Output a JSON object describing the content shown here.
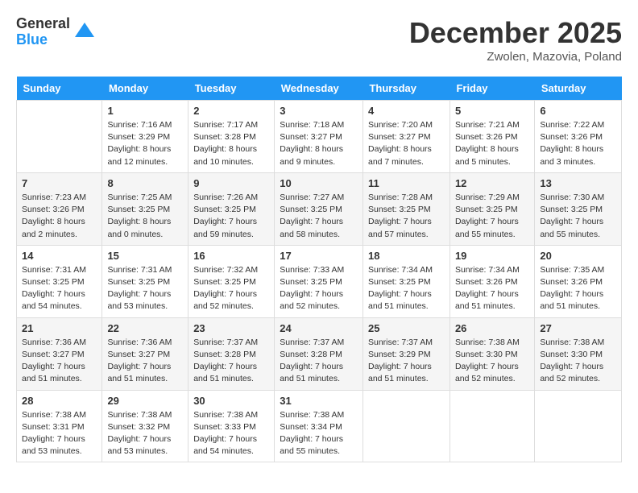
{
  "header": {
    "logo_general": "General",
    "logo_blue": "Blue",
    "month_title": "December 2025",
    "location": "Zwolen, Mazovia, Poland"
  },
  "days_of_week": [
    "Sunday",
    "Monday",
    "Tuesday",
    "Wednesday",
    "Thursday",
    "Friday",
    "Saturday"
  ],
  "weeks": [
    [
      {
        "day": "",
        "info": ""
      },
      {
        "day": "1",
        "info": "Sunrise: 7:16 AM\nSunset: 3:29 PM\nDaylight: 8 hours\nand 12 minutes."
      },
      {
        "day": "2",
        "info": "Sunrise: 7:17 AM\nSunset: 3:28 PM\nDaylight: 8 hours\nand 10 minutes."
      },
      {
        "day": "3",
        "info": "Sunrise: 7:18 AM\nSunset: 3:27 PM\nDaylight: 8 hours\nand 9 minutes."
      },
      {
        "day": "4",
        "info": "Sunrise: 7:20 AM\nSunset: 3:27 PM\nDaylight: 8 hours\nand 7 minutes."
      },
      {
        "day": "5",
        "info": "Sunrise: 7:21 AM\nSunset: 3:26 PM\nDaylight: 8 hours\nand 5 minutes."
      },
      {
        "day": "6",
        "info": "Sunrise: 7:22 AM\nSunset: 3:26 PM\nDaylight: 8 hours\nand 3 minutes."
      }
    ],
    [
      {
        "day": "7",
        "info": "Sunrise: 7:23 AM\nSunset: 3:26 PM\nDaylight: 8 hours\nand 2 minutes."
      },
      {
        "day": "8",
        "info": "Sunrise: 7:25 AM\nSunset: 3:25 PM\nDaylight: 8 hours\nand 0 minutes."
      },
      {
        "day": "9",
        "info": "Sunrise: 7:26 AM\nSunset: 3:25 PM\nDaylight: 7 hours\nand 59 minutes."
      },
      {
        "day": "10",
        "info": "Sunrise: 7:27 AM\nSunset: 3:25 PM\nDaylight: 7 hours\nand 58 minutes."
      },
      {
        "day": "11",
        "info": "Sunrise: 7:28 AM\nSunset: 3:25 PM\nDaylight: 7 hours\nand 57 minutes."
      },
      {
        "day": "12",
        "info": "Sunrise: 7:29 AM\nSunset: 3:25 PM\nDaylight: 7 hours\nand 55 minutes."
      },
      {
        "day": "13",
        "info": "Sunrise: 7:30 AM\nSunset: 3:25 PM\nDaylight: 7 hours\nand 55 minutes."
      }
    ],
    [
      {
        "day": "14",
        "info": "Sunrise: 7:31 AM\nSunset: 3:25 PM\nDaylight: 7 hours\nand 54 minutes."
      },
      {
        "day": "15",
        "info": "Sunrise: 7:31 AM\nSunset: 3:25 PM\nDaylight: 7 hours\nand 53 minutes."
      },
      {
        "day": "16",
        "info": "Sunrise: 7:32 AM\nSunset: 3:25 PM\nDaylight: 7 hours\nand 52 minutes."
      },
      {
        "day": "17",
        "info": "Sunrise: 7:33 AM\nSunset: 3:25 PM\nDaylight: 7 hours\nand 52 minutes."
      },
      {
        "day": "18",
        "info": "Sunrise: 7:34 AM\nSunset: 3:25 PM\nDaylight: 7 hours\nand 51 minutes."
      },
      {
        "day": "19",
        "info": "Sunrise: 7:34 AM\nSunset: 3:26 PM\nDaylight: 7 hours\nand 51 minutes."
      },
      {
        "day": "20",
        "info": "Sunrise: 7:35 AM\nSunset: 3:26 PM\nDaylight: 7 hours\nand 51 minutes."
      }
    ],
    [
      {
        "day": "21",
        "info": "Sunrise: 7:36 AM\nSunset: 3:27 PM\nDaylight: 7 hours\nand 51 minutes."
      },
      {
        "day": "22",
        "info": "Sunrise: 7:36 AM\nSunset: 3:27 PM\nDaylight: 7 hours\nand 51 minutes."
      },
      {
        "day": "23",
        "info": "Sunrise: 7:37 AM\nSunset: 3:28 PM\nDaylight: 7 hours\nand 51 minutes."
      },
      {
        "day": "24",
        "info": "Sunrise: 7:37 AM\nSunset: 3:28 PM\nDaylight: 7 hours\nand 51 minutes."
      },
      {
        "day": "25",
        "info": "Sunrise: 7:37 AM\nSunset: 3:29 PM\nDaylight: 7 hours\nand 51 minutes."
      },
      {
        "day": "26",
        "info": "Sunrise: 7:38 AM\nSunset: 3:30 PM\nDaylight: 7 hours\nand 52 minutes."
      },
      {
        "day": "27",
        "info": "Sunrise: 7:38 AM\nSunset: 3:30 PM\nDaylight: 7 hours\nand 52 minutes."
      }
    ],
    [
      {
        "day": "28",
        "info": "Sunrise: 7:38 AM\nSunset: 3:31 PM\nDaylight: 7 hours\nand 53 minutes."
      },
      {
        "day": "29",
        "info": "Sunrise: 7:38 AM\nSunset: 3:32 PM\nDaylight: 7 hours\nand 53 minutes."
      },
      {
        "day": "30",
        "info": "Sunrise: 7:38 AM\nSunset: 3:33 PM\nDaylight: 7 hours\nand 54 minutes."
      },
      {
        "day": "31",
        "info": "Sunrise: 7:38 AM\nSunset: 3:34 PM\nDaylight: 7 hours\nand 55 minutes."
      },
      {
        "day": "",
        "info": ""
      },
      {
        "day": "",
        "info": ""
      },
      {
        "day": "",
        "info": ""
      }
    ]
  ]
}
